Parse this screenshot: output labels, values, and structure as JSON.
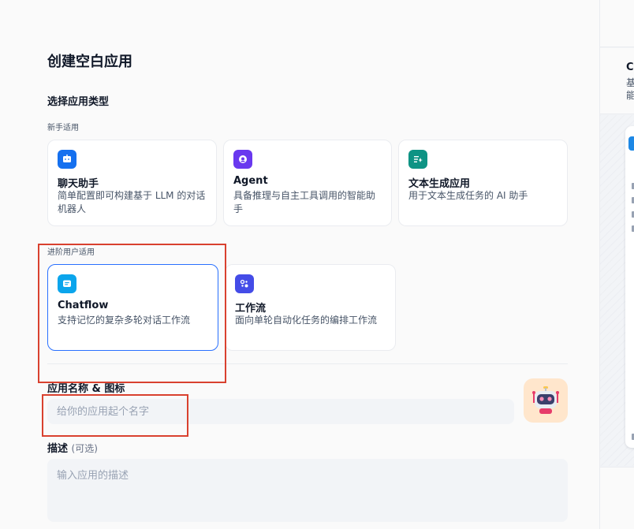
{
  "page": {
    "title": "创建空白应用",
    "section_title": "选择应用类型"
  },
  "groups": {
    "beginner_label": "新手适用",
    "advanced_label": "进阶用户适用"
  },
  "app_types": {
    "chatbot": {
      "name": "聊天助手",
      "desc": "简单配置即可构建基于 LLM 的对话机器人",
      "icon": "chat-icon",
      "color": "#1570ef"
    },
    "agent": {
      "name": "Agent",
      "desc": "具备推理与自主工具调用的智能助手",
      "icon": "agent-icon",
      "color": "#6938ef"
    },
    "completion": {
      "name": "文本生成应用",
      "desc": "用于文本生成任务的 AI 助手",
      "icon": "text-gen-icon",
      "color": "#0e9384"
    },
    "chatflow": {
      "name": "Chatflow",
      "desc": "支持记忆的复杂多轮对话工作流",
      "icon": "chatflow-icon",
      "color": "#0ba5ec",
      "selected": true
    },
    "workflow": {
      "name": "工作流",
      "desc": "面向单轮自动化任务的编排工作流",
      "icon": "workflow-icon",
      "color": "#444ce7"
    }
  },
  "form": {
    "name_label": "应用名称 & 图标",
    "name_placeholder": "给你的应用起个名字",
    "name_value": "",
    "desc_label": "描述",
    "desc_optional": "(可选)",
    "desc_placeholder": "输入应用的描述",
    "avatar_icon": "robot-icon"
  },
  "preview_panel": {
    "title": "Ch",
    "line1": "基",
    "line2": "能"
  },
  "colors": {
    "accent": "#2970ff",
    "annotation": "#d9412f"
  }
}
